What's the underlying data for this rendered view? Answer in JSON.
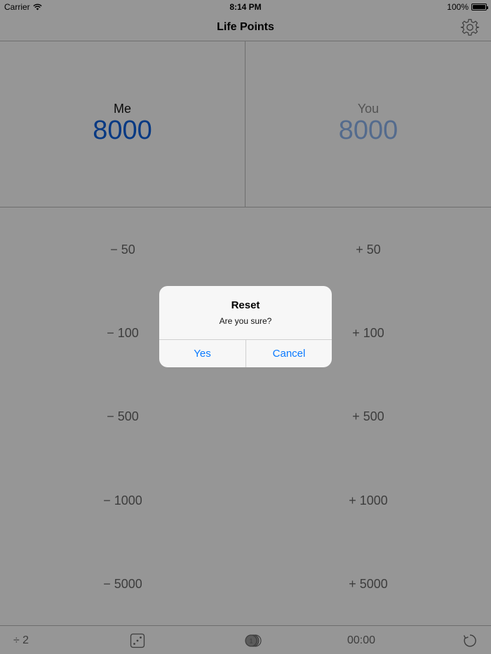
{
  "status_bar": {
    "carrier": "Carrier",
    "time": "8:14 PM",
    "battery": "100%",
    "battery_level": 1.0
  },
  "nav": {
    "title": "Life Points",
    "settings_icon": "gear-icon"
  },
  "players": [
    {
      "name": "Me",
      "score": "8000"
    },
    {
      "name": "You",
      "score": "8000"
    }
  ],
  "adjustments": {
    "minus": [
      "− 50",
      "− 100",
      "− 500",
      "− 1000",
      "− 5000"
    ],
    "plus": [
      "+ 50",
      "+ 100",
      "+ 500",
      "+ 1000",
      "+ 5000"
    ]
  },
  "toolbar": {
    "halve_label": "÷ 2",
    "dice_icon": "dice-icon",
    "coin_icon": "coin-icon",
    "timer": "00:00",
    "reset_icon": "refresh-icon"
  },
  "alert": {
    "title": "Reset",
    "message": "Are you sure?",
    "yes_label": "Yes",
    "cancel_label": "Cancel"
  },
  "colors": {
    "accent": "#0a7aff",
    "active_score": "#0a5fdb",
    "inactive_score": "#8cb3ec",
    "overlay": "rgba(0,0,0,0.4)"
  }
}
